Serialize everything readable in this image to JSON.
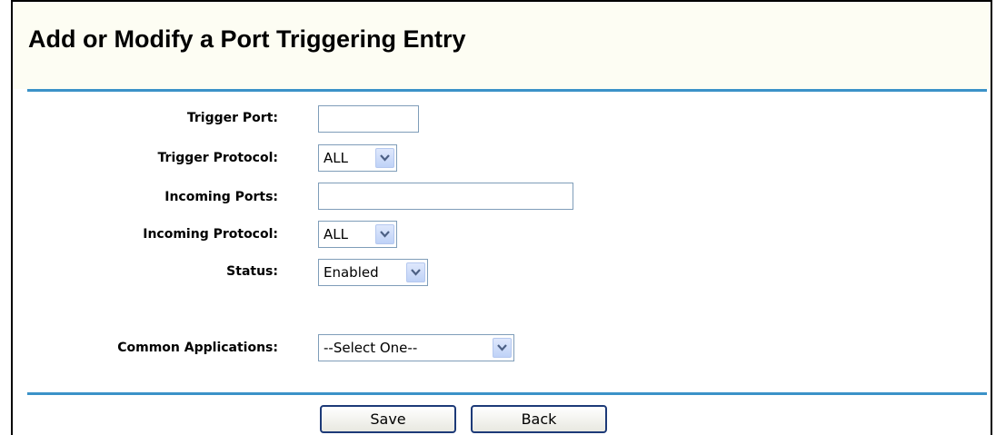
{
  "header": {
    "title": "Add or Modify a Port Triggering Entry"
  },
  "form": {
    "trigger_port": {
      "label": "Trigger Port:",
      "value": ""
    },
    "trigger_protocol": {
      "label": "Trigger Protocol:",
      "value": "ALL"
    },
    "incoming_ports": {
      "label": "Incoming Ports:",
      "value": ""
    },
    "incoming_protocol": {
      "label": "Incoming Protocol:",
      "value": "ALL"
    },
    "status": {
      "label": "Status:",
      "value": "Enabled"
    },
    "common_applications": {
      "label": "Common Applications:",
      "value": "--Select One--"
    }
  },
  "buttons": {
    "save": "Save",
    "back": "Back"
  },
  "icons": {
    "dropdown": "chevron-down-icon"
  },
  "colors": {
    "rule": "#3b92c8",
    "title_background": "#fdfdf3",
    "input_border": "#7f9db9",
    "dropdown_arrow": "#4d6185",
    "button_border": "#1d3a78"
  }
}
